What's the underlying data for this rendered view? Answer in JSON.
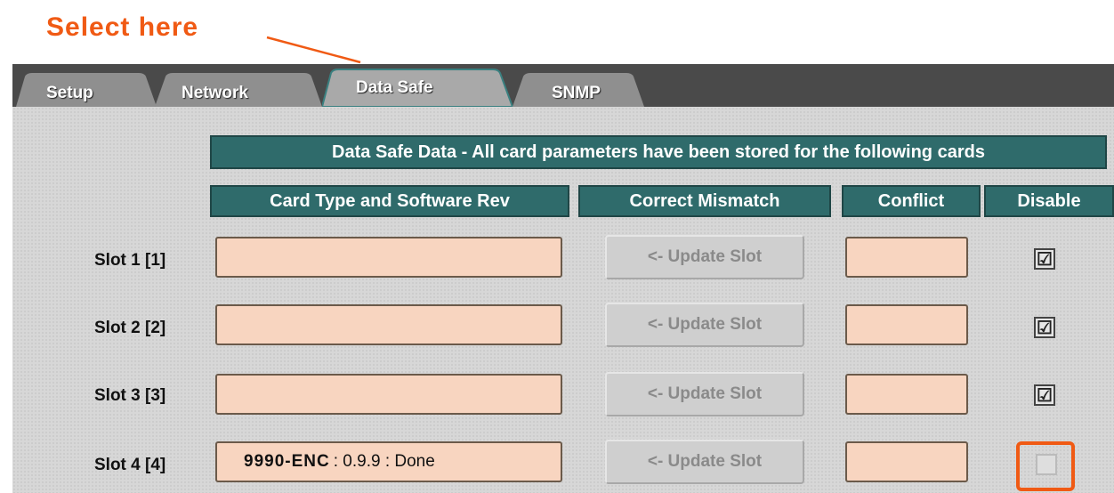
{
  "annotation": {
    "select_text": "Select here"
  },
  "tabs": [
    {
      "label": "Setup"
    },
    {
      "label": "Network"
    },
    {
      "label": "Data Safe"
    },
    {
      "label": "SNMP"
    }
  ],
  "panel": {
    "title": "Data Safe Data - All card parameters have been stored for the following cards",
    "columns": {
      "card": "Card Type and Software Rev",
      "mismatch": "Correct Mismatch",
      "conflict": "Conflict",
      "disable": "Disable"
    },
    "slots": [
      {
        "label": "Slot 1 [1]",
        "card_name": "",
        "card_rest": "",
        "update_label": "<- Update Slot",
        "conflict": "",
        "disabled": true
      },
      {
        "label": "Slot 2 [2]",
        "card_name": "",
        "card_rest": "",
        "update_label": "<- Update Slot",
        "conflict": "",
        "disabled": true
      },
      {
        "label": "Slot 3 [3]",
        "card_name": "",
        "card_rest": "",
        "update_label": "<- Update Slot",
        "conflict": "",
        "disabled": true
      },
      {
        "label": "Slot 4 [4]",
        "card_name": "9990-ENC",
        "card_rest": ": 0.9.9 : Done",
        "update_label": "<- Update Slot",
        "conflict": "",
        "disabled": false
      }
    ]
  },
  "colors": {
    "accent": "#f05a14",
    "header": "#2f6b6b",
    "field": "#f8d5c0",
    "tabbar": "#4a4a4a"
  },
  "icons": {
    "check": "☑"
  }
}
